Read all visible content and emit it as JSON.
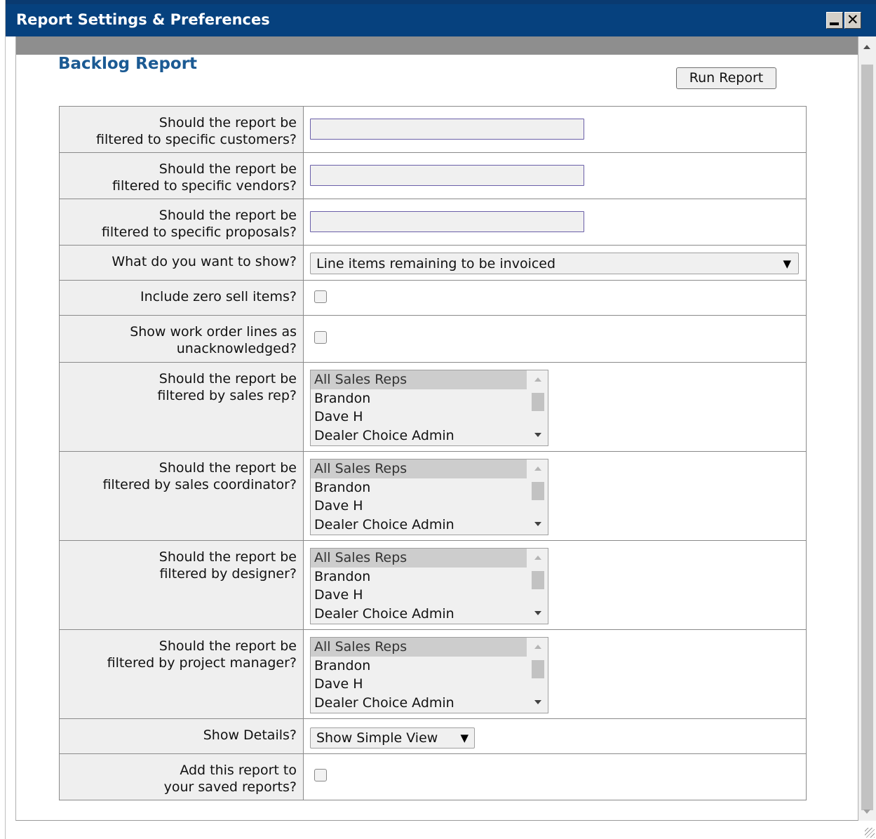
{
  "window": {
    "title": "Report Settings & Preferences",
    "title_bar_color": "#06417e",
    "minimize_icon": "minimize-icon",
    "close_icon": "close-icon",
    "close_glyph": "✕"
  },
  "report": {
    "title": "Backlog Report",
    "run_button": "Run Report"
  },
  "fields": {
    "customers": {
      "label_line1": "Should the report be",
      "label_line2": "filtered to specific customers?",
      "value": ""
    },
    "vendors": {
      "label_line1": "Should the report be",
      "label_line2": "filtered to specific vendors?",
      "value": ""
    },
    "proposals": {
      "label_line1": "Should the report be",
      "label_line2": "filtered to specific proposals?",
      "value": ""
    },
    "show": {
      "label": "What do you want to show?",
      "selected": "Line items remaining to be invoiced"
    },
    "zero_sell": {
      "label": "Include zero sell items?",
      "checked": false
    },
    "work_order": {
      "label_line1": "Show work order lines as",
      "label_line2": "unacknowledged?",
      "checked": false
    },
    "sales_rep": {
      "label_line1": "Should the report be",
      "label_line2": "filtered by sales rep?",
      "options": [
        "All Sales Reps",
        "Brandon",
        "Dave H",
        "Dealer Choice Admin"
      ]
    },
    "sales_coordinator": {
      "label_line1": "Should the report be",
      "label_line2": "filtered by sales coordinator?",
      "options": [
        "All Sales Reps",
        "Brandon",
        "Dave H",
        "Dealer Choice Admin"
      ]
    },
    "designer": {
      "label_line1": "Should the report be",
      "label_line2": "filtered by designer?",
      "options": [
        "All Sales Reps",
        "Brandon",
        "Dave H",
        "Dealer Choice Admin"
      ]
    },
    "project_manager": {
      "label_line1": "Should the report be",
      "label_line2": "filtered by project manager?",
      "options": [
        "All Sales Reps",
        "Brandon",
        "Dave H",
        "Dealer Choice Admin"
      ]
    },
    "details": {
      "label": "Show Details?",
      "selected": "Show Simple View"
    },
    "save": {
      "label_line1": "Add this report to",
      "label_line2": "your saved reports?",
      "checked": false
    }
  },
  "glyphs": {
    "dropdown_arrow": "▼"
  }
}
